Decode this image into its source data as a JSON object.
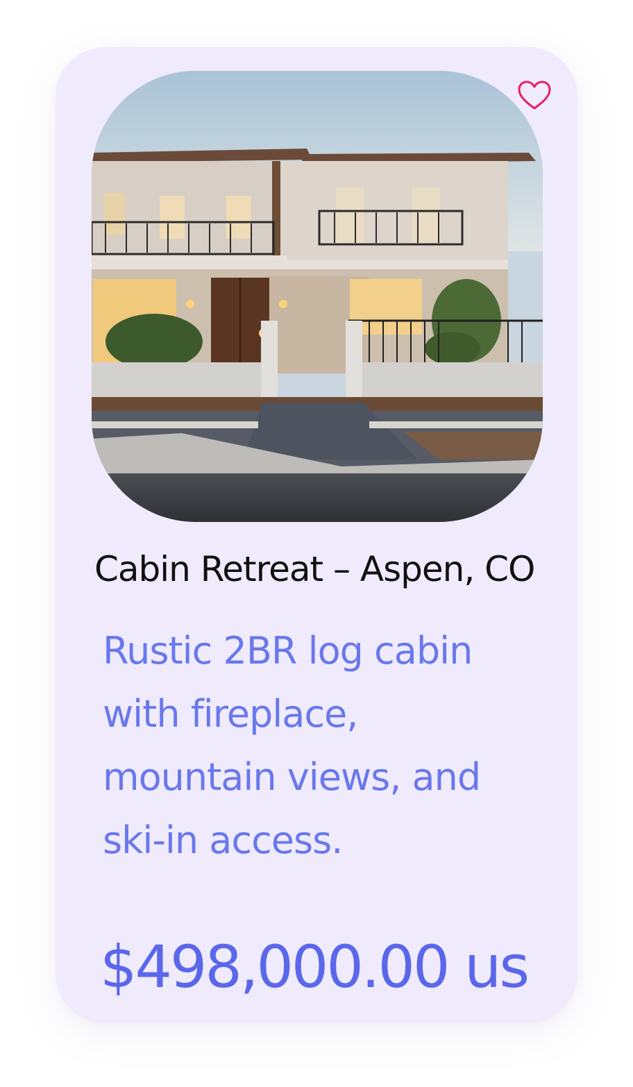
{
  "listing": {
    "title": "Cabin Retreat – Aspen, CO",
    "description": "Rustic 2BR log cabin with fireplace, mountain views, and ski-in access.",
    "price": "$498,000.00 us",
    "favorite_icon": "heart-outline-icon",
    "photo": "house-photo"
  },
  "colors": {
    "card_background": "#efebfd",
    "description_text": "#6a78ec",
    "price_text": "#5b67ea",
    "heart_accent": "#e91e63",
    "title_text": "#111111"
  }
}
